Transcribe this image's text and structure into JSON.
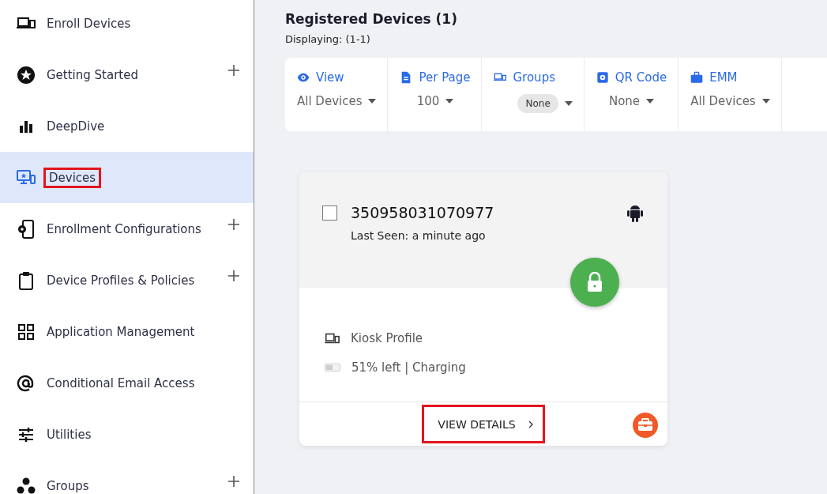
{
  "sidebar": {
    "items": [
      {
        "label": "Enroll Devices",
        "selected": false,
        "expandable": false,
        "highlighted": false
      },
      {
        "label": "Getting Started",
        "selected": false,
        "expandable": true,
        "highlighted": false
      },
      {
        "label": "DeepDive",
        "selected": false,
        "expandable": false,
        "highlighted": false
      },
      {
        "label": "Devices",
        "selected": true,
        "expandable": false,
        "highlighted": true
      },
      {
        "label": "Enrollment Configurations",
        "selected": false,
        "expandable": true,
        "highlighted": false
      },
      {
        "label": "Device Profiles & Policies",
        "selected": false,
        "expandable": true,
        "highlighted": false
      },
      {
        "label": "Application Management",
        "selected": false,
        "expandable": false,
        "highlighted": false
      },
      {
        "label": "Conditional Email Access",
        "selected": false,
        "expandable": false,
        "highlighted": false
      },
      {
        "label": "Utilities",
        "selected": false,
        "expandable": false,
        "highlighted": false
      },
      {
        "label": "Groups",
        "selected": false,
        "expandable": true,
        "highlighted": false
      }
    ]
  },
  "header": {
    "title": "Registered Devices (1)",
    "subtitle": "Displaying: (1-1)"
  },
  "filters": [
    {
      "label": "View",
      "value": "All Devices",
      "kind": "dropdown"
    },
    {
      "label": "Per Page",
      "value": "100",
      "kind": "dropdown"
    },
    {
      "label": "Groups",
      "value": "None",
      "kind": "chip"
    },
    {
      "label": "QR Code",
      "value": "None",
      "kind": "dropdown"
    },
    {
      "label": "EMM",
      "value": "All Devices",
      "kind": "dropdown"
    }
  ],
  "device_card": {
    "checked": false,
    "name": "350958031070977",
    "last_seen": "Last Seen: a minute ago",
    "locked": true,
    "profile": "Kiosk Profile",
    "battery": "51% left | Charging",
    "level": 0.51,
    "action": "VIEW DETAILS",
    "action_highlighted": true
  }
}
